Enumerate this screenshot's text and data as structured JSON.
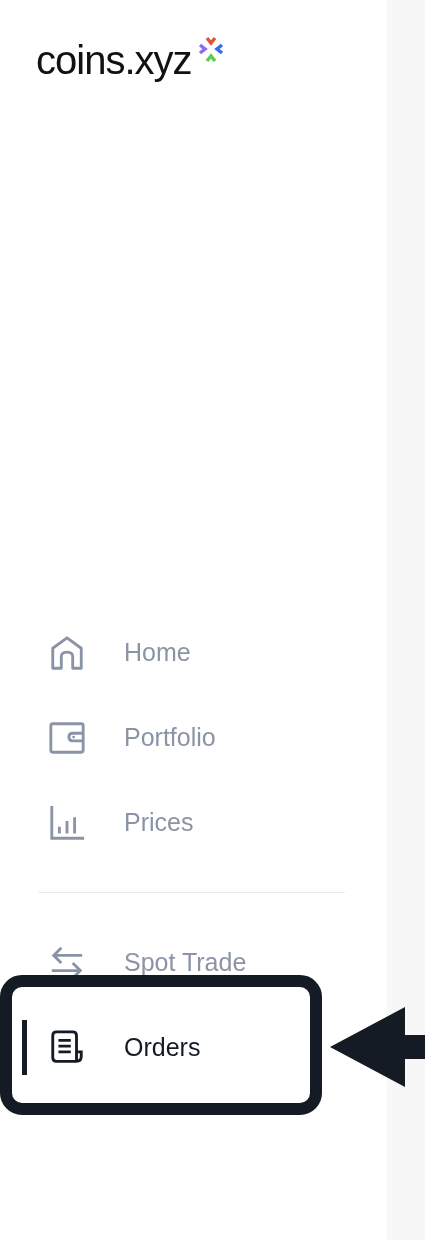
{
  "logo": {
    "text": "coins.xyz"
  },
  "nav_groups": [
    {
      "items": [
        {
          "label": "Home",
          "kind": "home",
          "selected": false
        },
        {
          "label": "Portfolio",
          "kind": "wallet",
          "selected": false
        },
        {
          "label": "Prices",
          "kind": "chart",
          "selected": false
        }
      ]
    },
    {
      "items": [
        {
          "label": "Spot Trade",
          "kind": "swap",
          "selected": false
        },
        {
          "label": "Orders",
          "kind": "orders",
          "selected": true
        }
      ]
    }
  ]
}
